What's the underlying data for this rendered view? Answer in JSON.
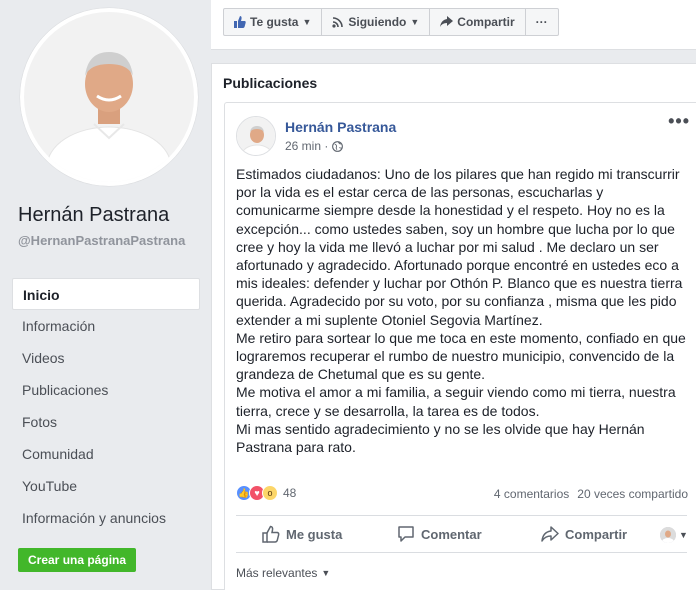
{
  "page": {
    "name": "Hernán Pastrana",
    "handle": "@HernanPastranaPastrana"
  },
  "nav": {
    "items": [
      "Inicio",
      "Información",
      "Videos",
      "Publicaciones",
      "Fotos",
      "Comunidad",
      "YouTube",
      "Información y anuncios"
    ],
    "active": "Inicio",
    "create_page": "Crear una página"
  },
  "action_bar": {
    "like": "Te gusta",
    "follow": "Siguiendo",
    "share": "Compartir",
    "more": "···"
  },
  "section": {
    "title": "Publicaciones"
  },
  "post": {
    "author": "Hernán Pastrana",
    "time": "26 min ·",
    "privacy_icon": "globe-icon",
    "more": "•••",
    "text": "Estimados ciudadanos: Uno de los pilares que han regido mi transcurrir\npor la vida es el estar cerca de las personas, escucharlas y\ncomunicarme siempre desde la honestidad y el respeto. Hoy no es la\nexcepción... como ustedes saben, soy un hombre que lucha por lo que\ncree y hoy la vida me llevó a luchar por mi salud . Me declaro un ser\nafortunado y agradecido. Afortunado porque encontré en ustedes eco a\nmis ideales: defender y luchar por Othón P. Blanco que es nuestra tierra\nquerida. Agradecido por su voto, por su confianza , misma que les pido\nextender a mi suplente Otoniel Segovia Martínez.\nMe retiro para sortear lo que me toca en este momento, confiado en que\nlograremos recuperar el rumbo de nuestro municipio, convencido de la\ngrandeza de Chetumal que es su gente.\nMe motiva el amor a mi familia, a seguir viendo como mi tierra, nuestra\ntierra, crece y se desarrolla, la tarea es de todos.\nMi mas sentido agradecimiento y no se les olvide que hay Hernán\nPastrana para rato.",
    "reaction_count": "48",
    "comments": "4 comentarios",
    "shares": "20 veces compartido",
    "actions": {
      "like": "Me gusta",
      "comment": "Comentar",
      "share": "Compartir"
    },
    "sort": "Más relevantes"
  },
  "colors": {
    "link": "#365899",
    "like_blue": "#5890ff",
    "love_red": "#f25268",
    "wow_yellow": "#fcd669",
    "create_green": "#42b72a"
  }
}
